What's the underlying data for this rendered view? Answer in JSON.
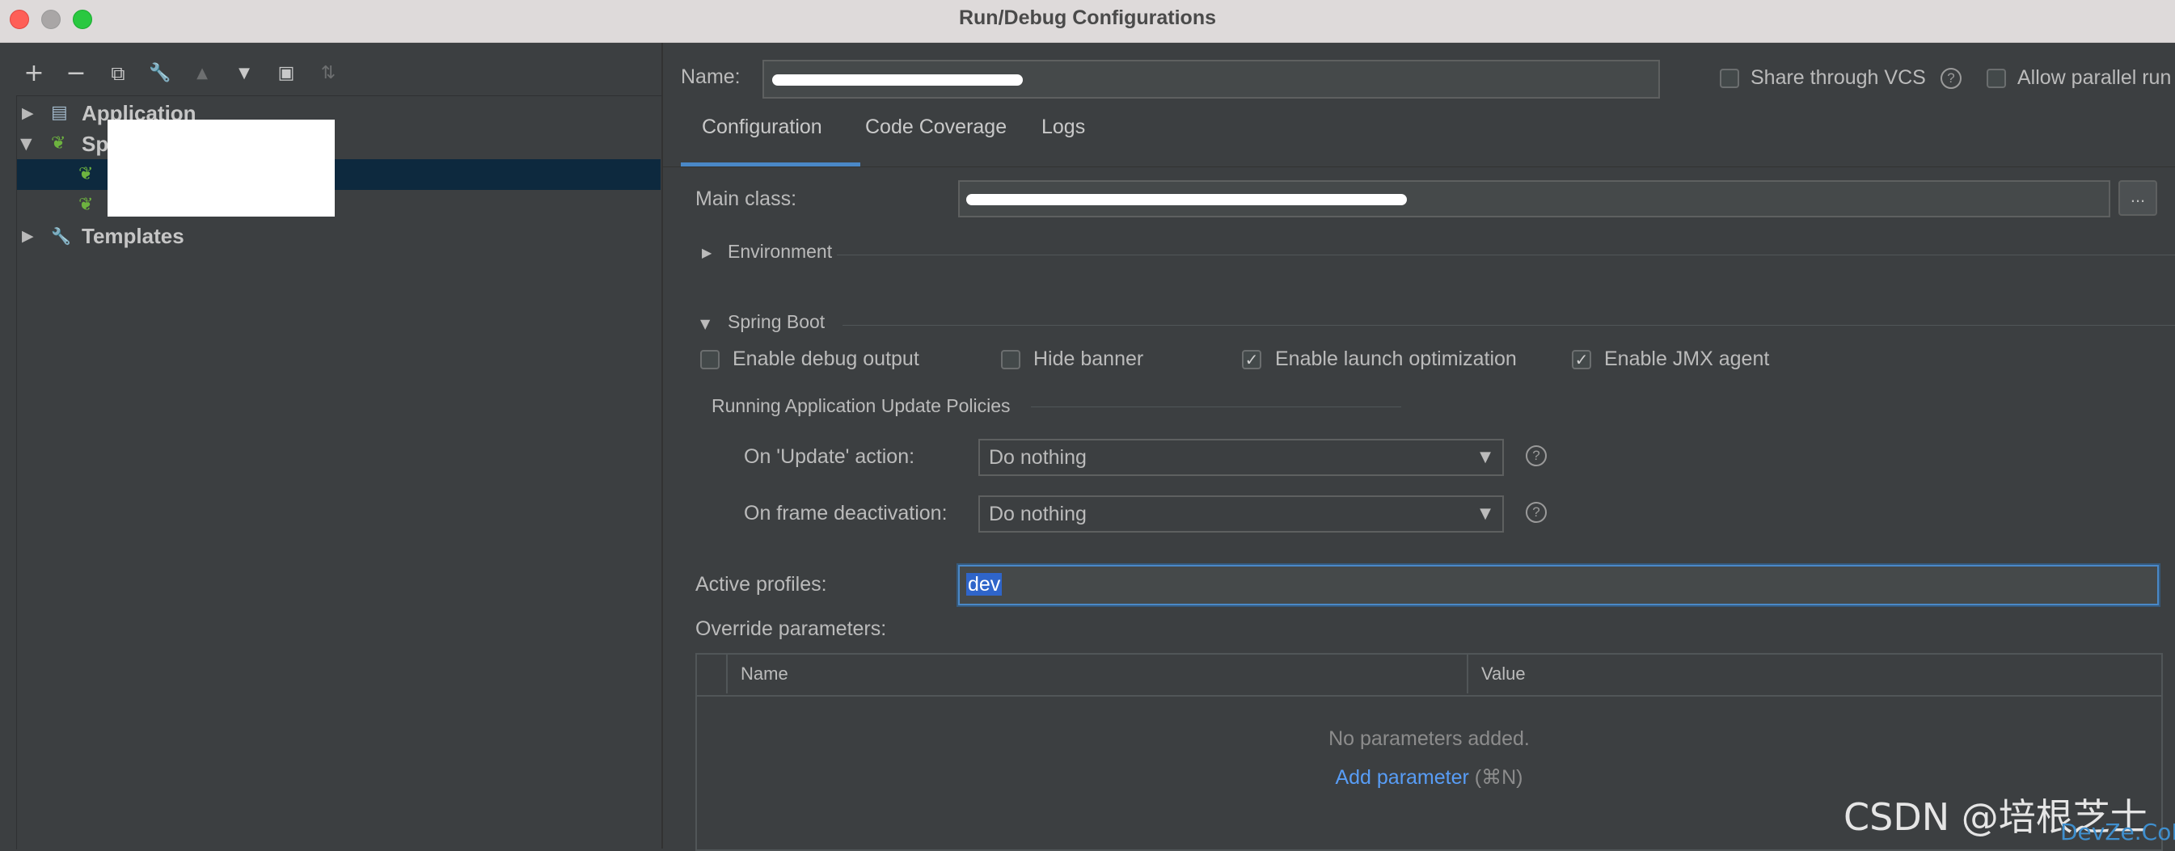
{
  "window": {
    "title": "Run/Debug Configurations"
  },
  "toolbar": {
    "icons": [
      "plus-icon",
      "minus-icon",
      "copy-icon",
      "wrench-icon",
      "arrow-up-icon",
      "arrow-down-icon",
      "new-folder-icon",
      "sort-icon"
    ],
    "glyphs": {
      "plus": "+",
      "minus": "−",
      "copy": "⧉",
      "wrench": "🔧",
      "up": "▲",
      "down": "▼",
      "folder": "▣",
      "sort": "⇅"
    }
  },
  "tree": {
    "items": [
      {
        "label": "Application",
        "expanded": false,
        "icon": "application-icon"
      },
      {
        "label": "Spring Boot",
        "expanded": true,
        "icon": "spring-boot-icon"
      },
      {
        "label": "Templates",
        "expanded": false,
        "icon": "wrench-icon"
      }
    ],
    "glyphs": {
      "collapsed": "▶",
      "expanded": "▼",
      "app": "▤",
      "spring": "❦",
      "wrench": "🔧"
    }
  },
  "header": {
    "name_label": "Name:",
    "share_vcs_label": "Share through VCS",
    "share_vcs_checked": false,
    "allow_parallel_label": "Allow parallel run",
    "allow_parallel_checked": false
  },
  "tabs": [
    {
      "label": "Configuration",
      "active": true
    },
    {
      "label": "Code Coverage",
      "active": false
    },
    {
      "label": "Logs",
      "active": false
    }
  ],
  "config": {
    "main_class_label": "Main class:",
    "browse_label": "...",
    "environment_label": "Environment",
    "environment_expanded": false,
    "spring_boot_section_label": "Spring Boot",
    "spring_boot_expanded": true,
    "checkboxes": [
      {
        "label": "Enable debug output",
        "checked": false
      },
      {
        "label": "Hide banner",
        "checked": false
      },
      {
        "label": "Enable launch optimization",
        "checked": true
      },
      {
        "label": "Enable JMX agent",
        "checked": true
      }
    ],
    "update_policies_label": "Running Application Update Policies",
    "on_update_label": "On 'Update' action:",
    "on_update_value": "Do nothing",
    "on_frame_label": "On frame deactivation:",
    "on_frame_value": "Do nothing",
    "active_profiles_label": "Active profiles:",
    "active_profiles_value": "dev",
    "override_params_label": "Override parameters:",
    "table": {
      "columns": [
        "Name",
        "Value"
      ],
      "empty_text": "No parameters added.",
      "add_link": "Add parameter",
      "add_shortcut": "(⌘N)"
    }
  },
  "glyphs": {
    "help": "?",
    "check": "✓",
    "dropdown": "▼",
    "collapsed": "▶",
    "expanded": "▼"
  },
  "colors": {
    "background": "#3c3f41",
    "selection": "#0d293e",
    "accent": "#4a88c7",
    "link": "#589df6"
  },
  "watermark": {
    "csdn": "CSDN @培根芝士",
    "devze": "DevZe.CoM"
  }
}
